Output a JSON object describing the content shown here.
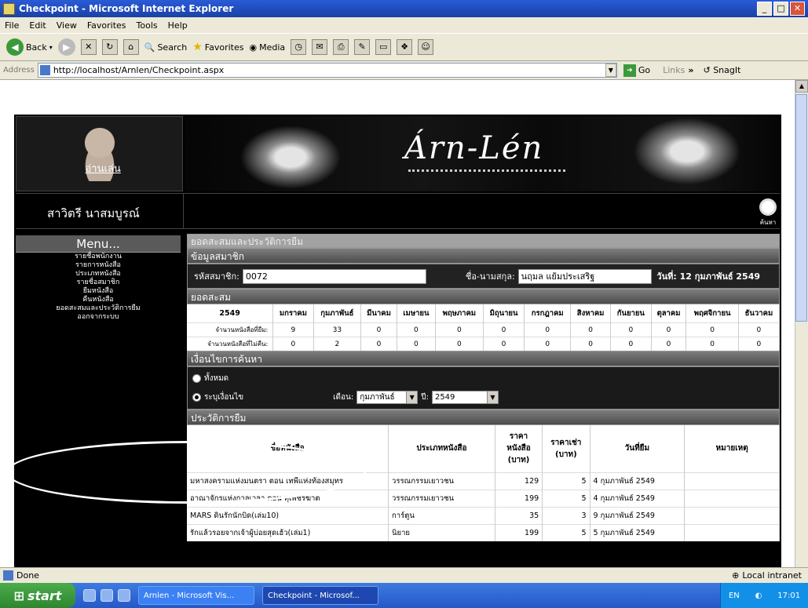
{
  "window": {
    "title": "Checkpoint - Microsoft Internet Explorer"
  },
  "menubar": [
    "File",
    "Edit",
    "View",
    "Favorites",
    "Tools",
    "Help"
  ],
  "toolbar": {
    "back": "Back",
    "search": "Search",
    "favorites": "Favorites",
    "media": "Media"
  },
  "address": {
    "label": "Address",
    "url": "http://localhost/Arnlen/Checkpoint.aspx",
    "go": "Go",
    "links": "Links",
    "snagit": "SnagIt"
  },
  "site": {
    "logo_text": "อ่านเล่น",
    "brand": "Árn-Lén",
    "user_name": "สาวิตรี นาสมบูรณ์",
    "search_label": "ค้นหา"
  },
  "menu": {
    "title": "Menu...",
    "items": [
      "รายชื่อพนักงาน",
      "รายการหนังสือ",
      "ประเภทหนังสือ",
      "รายชื่อสมาชิก",
      "ยืมหนังสือ",
      "คืนหนังสือ",
      "ยอดสะสมและประวัติการยืม",
      "ออกจากระบบ"
    ]
  },
  "main": {
    "heading": "ยอดสะสมและประวัติการยืม",
    "member_heading": "ข้อมูลสมาชิก",
    "member_id_label": "รหัสสมาชิก:",
    "member_id": "0072",
    "member_name_label": "ชื่อ-นามสกุล:",
    "member_name": "นฤมล แย้มประเสริฐ",
    "date_label": "วันที่:",
    "date": "12 กุมภาพันธ์ 2549"
  },
  "stats": {
    "heading": "ยอดสะสม",
    "year": "2549",
    "months": [
      "มกราคม",
      "กุมภาพันธ์",
      "มีนาคม",
      "เมษายน",
      "พฤษภาคม",
      "มิถุนายน",
      "กรกฎาคม",
      "สิงหาคม",
      "กันยายน",
      "ตุลาคม",
      "พฤศจิกายน",
      "ธันวาคม"
    ],
    "rows": [
      {
        "label": "จำนวนหนังสือที่ยืม:",
        "values": [
          "9",
          "33",
          "0",
          "0",
          "0",
          "0",
          "0",
          "0",
          "0",
          "0",
          "0",
          "0"
        ]
      },
      {
        "label": "จำนวนหนังสือที่ไม่คืน:",
        "values": [
          "0",
          "2",
          "0",
          "0",
          "0",
          "0",
          "0",
          "0",
          "0",
          "0",
          "0",
          "0"
        ]
      }
    ]
  },
  "conditions": {
    "heading": "เงื่อนไขการค้นหา",
    "option_all": "ทั้งหมด",
    "option_specify": "ระบุเงื่อนไข",
    "month_label": "เดือน:",
    "month_value": "กุมภาพันธ์",
    "year_label": "ปี:",
    "year_value": "2549"
  },
  "history": {
    "heading": "ประวัติการยืม",
    "columns": [
      "ชื่อหนังสือ",
      "ประเภทหนังสือ",
      "ราคาหนังสือ (บาท)",
      "ราคาเช่า (บาท)",
      "วันที่ยืม",
      "หมายเหตุ"
    ],
    "rows": [
      [
        "มหาสงครามแห่งมนตรา ตอน เทพีแห่งท้องสมุทร",
        "วรรณกรรมเยาวชน",
        "129",
        "5",
        "4 กุมภาพันธ์ 2549",
        ""
      ],
      [
        "อาณาจักรแห่งกาลเวลา ตอน ทุเพชรฆาต",
        "วรรณกรรมเยาวชน",
        "199",
        "5",
        "4 กุมภาพันธ์ 2549",
        ""
      ],
      [
        "MARS ดินรักนักบิด(เล่ม10)",
        "การ์ตูน",
        "35",
        "3",
        "9 กุมภาพันธ์ 2549",
        ""
      ],
      [
        "รักแล้วรอยจากเจ้าผู้บ่อยสุดเฮ้ว(เล่ม1)",
        "นิยาย",
        "199",
        "5",
        "5 กุมภาพันธ์ 2549",
        ""
      ]
    ]
  },
  "status": {
    "text": "Done",
    "zone": "Local intranet"
  },
  "taskbar": {
    "start": "start",
    "tasks": [
      "Arnlen - Microsoft Vis...",
      "Checkpoint - Microsof..."
    ],
    "lang": "EN",
    "clock": "17:01"
  }
}
